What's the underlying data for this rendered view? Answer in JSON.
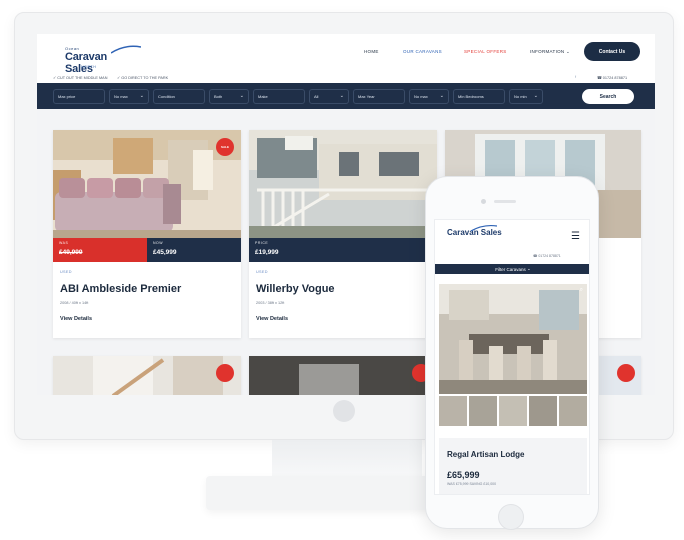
{
  "header": {
    "logo_top": "Ocean",
    "logo_main": "Caravan Sales",
    "logo_sub": "NORTH",
    "nav": [
      "HOME",
      "OUR CARAVANS",
      "SPECIAL OFFERS",
      "INFORMATION"
    ],
    "contact_label": "Contact Us"
  },
  "subbar": {
    "left1": "CUT OUT THE MIDDLE MAN",
    "left2": "GO DIRECT TO THE PARK",
    "phone": "01724 878871"
  },
  "search": {
    "filters": [
      {
        "label": "Max price",
        "value": "No max"
      },
      {
        "label": "Condition",
        "value": "Both"
      },
      {
        "label": "Make",
        "value": "All"
      },
      {
        "label": "Max Year",
        "value": "No max"
      },
      {
        "label": "Min Bedrooms",
        "value": "No min"
      }
    ],
    "button": "Search"
  },
  "cards": [
    {
      "condition": "USED",
      "title": "ABI Ambleside Premier",
      "meta": "2008 / 40ft x 14ft",
      "was_label": "WAS",
      "was_price": "£49,999",
      "now_label": "NOW",
      "now_price": "£45,999",
      "badge": "SALE",
      "details": "View Details"
    },
    {
      "condition": "USED",
      "title": "Willerby Vogue",
      "meta": "2003 / 38ft x 12ft",
      "price_label": "PRICE",
      "price": "£19,999",
      "details": "View Details"
    }
  ],
  "phone": {
    "logo_main": "Caravan Sales",
    "phone": "01724 878871",
    "filter_label": "Filter Caravans",
    "listing_title": "Regal Artisan Lodge",
    "listing_price": "£65,999",
    "listing_small": "WAS £75,999   SAVING £10,000"
  }
}
